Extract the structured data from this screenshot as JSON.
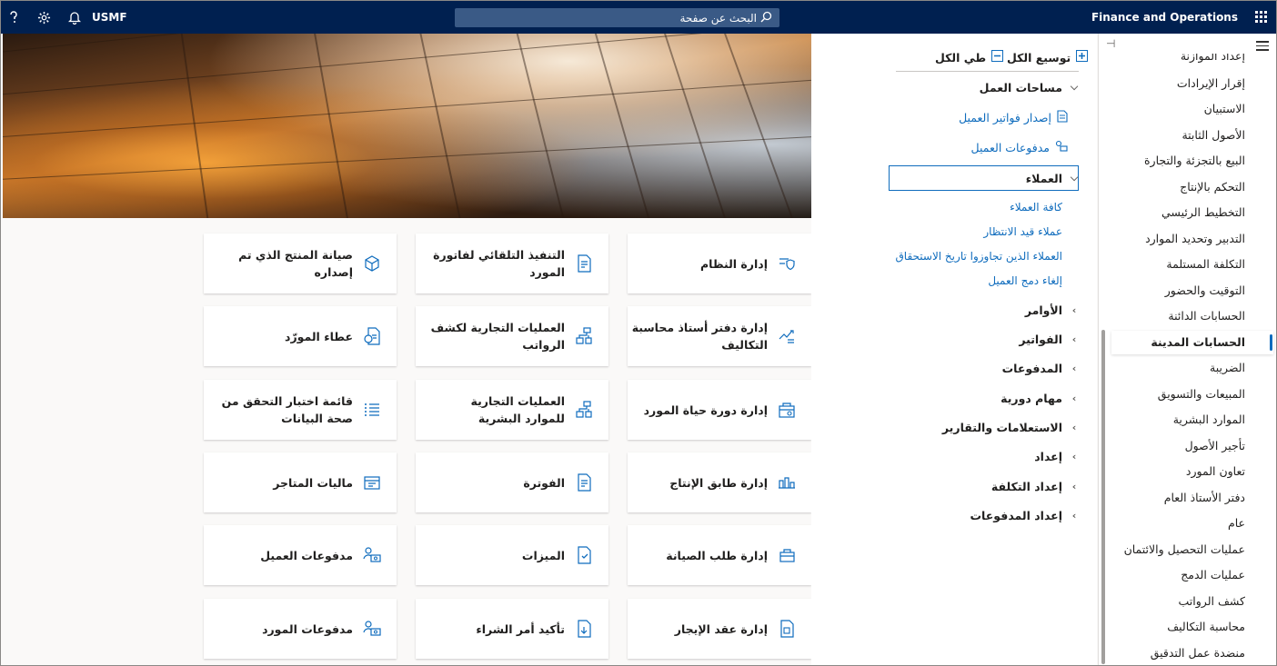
{
  "topbar": {
    "company": "USMF",
    "search_placeholder": "البحث عن صفحة",
    "app_title": "Finance and Operations",
    "icons": [
      "help-icon",
      "settings-icon",
      "notification-icon",
      "search-icon",
      "app-launcher-icon"
    ]
  },
  "tiles": [
    {
      "label": "إدارة النظام",
      "icon": "shield-icon"
    },
    {
      "label": "التنفيذ التلقائي لفاتورة المورد",
      "icon": "invoice-icon"
    },
    {
      "label": "صيانة المنتج الذي تم إصداره",
      "icon": "cube-icon"
    },
    {
      "label": "إدارة دفتر أستاذ محاسبة التكاليف",
      "icon": "chart-ledger-icon"
    },
    {
      "label": "العمليات التجارية لكشف الرواتب",
      "icon": "workflow-icon"
    },
    {
      "label": "عطاء المورّد",
      "icon": "bid-icon"
    },
    {
      "label": "إدارة دورة حياة المورد",
      "icon": "vendor-lifecycle-icon"
    },
    {
      "label": "العمليات التجارية للموارد البشرية",
      "icon": "workflow-icon"
    },
    {
      "label": "قائمة اختبار التحقق من صحة البيانات",
      "icon": "checklist-icon"
    },
    {
      "label": "إدارة طابق الإنتاج",
      "icon": "factory-icon"
    },
    {
      "label": "الفوترة",
      "icon": "invoice-icon"
    },
    {
      "label": "ماليات المتاجر",
      "icon": "store-icon"
    },
    {
      "label": "إدارة طلب الصيانة",
      "icon": "maintenance-icon"
    },
    {
      "label": "الميزات",
      "icon": "features-icon"
    },
    {
      "label": "مدفوعات العميل",
      "icon": "customer-payment-icon"
    },
    {
      "label": "إدارة عقد الإيجار",
      "icon": "lease-icon"
    },
    {
      "label": "تأكيد أمر الشراء",
      "icon": "purchase-order-icon"
    },
    {
      "label": "مدفوعات المورد",
      "icon": "vendor-payment-icon"
    }
  ],
  "middle_panel": {
    "expand_all": "توسيع الكل",
    "collapse_all": "طي الكل",
    "workspaces_header": "مساحات العمل",
    "workspaces": [
      "إصدار فواتير العميل",
      "مدفوعات العميل"
    ],
    "customers_header": "العملاء",
    "customers_links": [
      "كافة العملاء",
      "عملاء قيد الانتظار",
      "العملاء الذين تجاوزوا تاريخ الاستحقاق",
      "إلغاء دمج العميل"
    ],
    "groups": [
      "الأوامر",
      "الفواتير",
      "المدفوعات",
      "مهام دورية",
      "الاستعلامات والتقارير",
      "إعداد",
      "إعداد التكلفة",
      "إعداد المدفوعات"
    ]
  },
  "nav": {
    "items": [
      "إعداد الموازنة",
      "إقرار الإيرادات",
      "الاستبيان",
      "الأصول الثابتة",
      "البيع بالتجزئة والتجارة",
      "التحكم بالإنتاج",
      "التخطيط الرئيسي",
      "التدبير وتحديد الموارد",
      "التكلفة المستلمة",
      "التوقيت والحضور",
      "الحسابات الدائنة",
      "الحسابات المدينة",
      "الضريبة",
      "المبيعات والتسويق",
      "الموارد البشرية",
      "تأجير الأصول",
      "تعاون المورد",
      "دفتر الأستاذ العام",
      "عام",
      "عمليات التحصيل والائتمان",
      "عمليات الدمج",
      "كشف الرواتب",
      "محاسبة التكاليف",
      "منضدة عمل التدقيق"
    ],
    "active_index": 11
  },
  "colors": {
    "topbar": "#002050",
    "accent": "#0f6cbd"
  }
}
